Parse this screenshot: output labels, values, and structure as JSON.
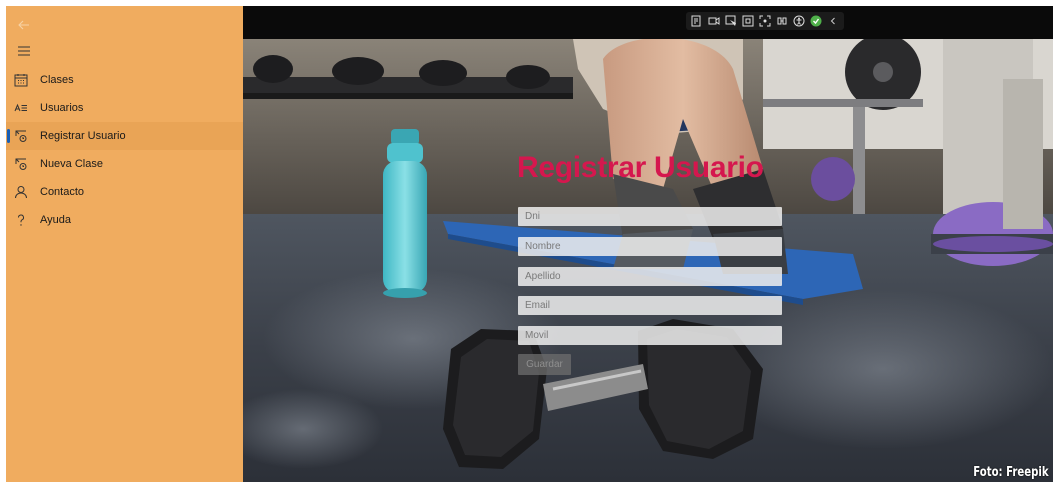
{
  "window": {
    "devtools_icons": [
      "live-visual-tree-icon",
      "video-icon",
      "select-element-icon",
      "layout-adorner-icon",
      "track-focus-icon",
      "binding-icon",
      "accessibility-icon",
      "check-icon",
      "collapse-chevron-icon"
    ]
  },
  "sidebar": {
    "items": [
      {
        "label": "Clases",
        "icon": "calendar-icon",
        "selected": false
      },
      {
        "label": "Usuarios",
        "icon": "list-icon",
        "selected": false
      },
      {
        "label": "Registrar Usuario",
        "icon": "register-icon",
        "selected": true
      },
      {
        "label": "Nueva Clase",
        "icon": "register-icon",
        "selected": false
      },
      {
        "label": "Contacto",
        "icon": "person-icon",
        "selected": false
      },
      {
        "label": "Ayuda",
        "icon": "help-icon",
        "selected": false
      }
    ],
    "accent": "#1a5fb4",
    "background": "#f0ac5f"
  },
  "form": {
    "title": "Registrar Usuario",
    "title_color": "#d5174e",
    "fields": {
      "dni": "Dni",
      "nombre": "Nombre",
      "apellido": "Apellido",
      "email": "Email",
      "movil": "Movil"
    },
    "submit_label": "Guardar"
  },
  "background": {
    "credit": "Foto: Freepik"
  }
}
